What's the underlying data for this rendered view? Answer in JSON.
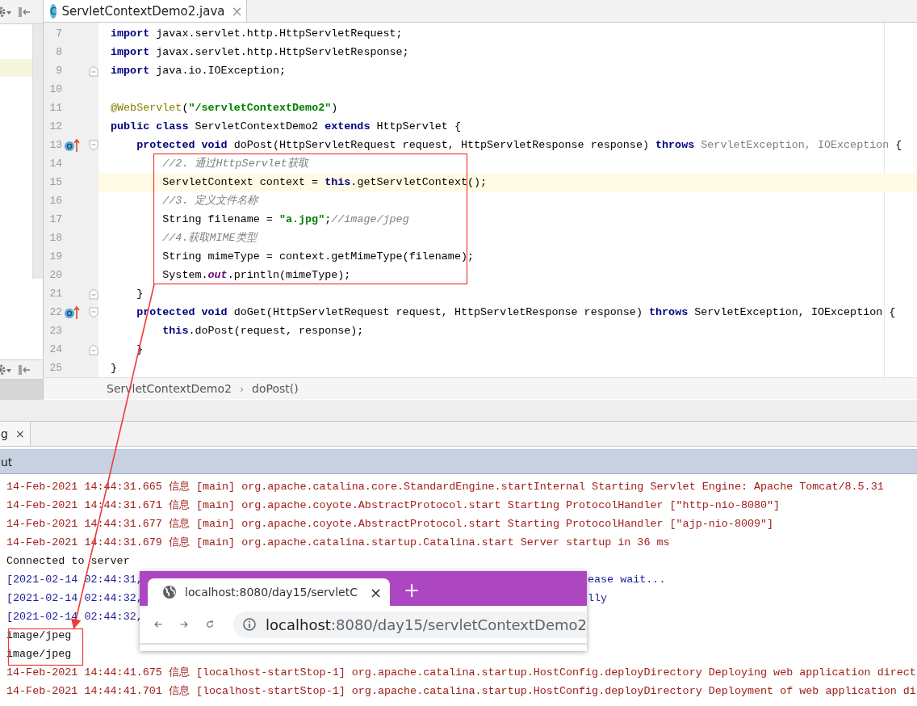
{
  "file_tab": {
    "icon_letter": "C",
    "title": "ServletContextDemo2.java",
    "close": "×",
    "selected": true
  },
  "code_lines": [
    {
      "number": "7",
      "current": false,
      "override": false,
      "fold_start": false,
      "fold_end": false,
      "tokens": [
        {
          "kind": "keyword",
          "text": "import"
        },
        {
          "kind": "plain",
          "text": " javax.servlet.http.HttpServletRequest;"
        }
      ]
    },
    {
      "number": "8",
      "current": false,
      "override": false,
      "fold_start": false,
      "fold_end": false,
      "tokens": [
        {
          "kind": "keyword",
          "text": "import"
        },
        {
          "kind": "plain",
          "text": " javax.servlet.http.HttpServletResponse;"
        }
      ]
    },
    {
      "number": "9",
      "current": false,
      "override": false,
      "fold_start": false,
      "fold_end": true,
      "tokens": [
        {
          "kind": "keyword",
          "text": "import"
        },
        {
          "kind": "plain",
          "text": " java.io.IOException;"
        }
      ]
    },
    {
      "number": "10",
      "current": false,
      "override": false,
      "fold_start": false,
      "fold_end": false
    },
    {
      "number": "11",
      "current": false,
      "override": false,
      "fold_start": false,
      "fold_end": false,
      "tokens": [
        {
          "kind": "annotation",
          "text": "@WebServlet"
        },
        {
          "kind": "plain",
          "text": "("
        },
        {
          "kind": "string",
          "text": "\"/servletContextDemo2\""
        },
        {
          "kind": "plain",
          "text": ")"
        }
      ]
    },
    {
      "number": "12",
      "current": false,
      "override": false,
      "fold_start": false,
      "fold_end": false,
      "tokens": [
        {
          "kind": "keyword",
          "text": "public class"
        },
        {
          "kind": "plain",
          "text": " ServletContextDemo2 "
        },
        {
          "kind": "keyword",
          "text": "extends"
        },
        {
          "kind": "plain",
          "text": " HttpServlet {"
        }
      ]
    },
    {
      "number": "13",
      "current": false,
      "override": true,
      "fold_start": true,
      "fold_end": false,
      "tokens": [
        {
          "kind": "keyword",
          "text": "    protected void"
        },
        {
          "kind": "plain",
          "text": " doPost(HttpServletRequest request, HttpServletResponse response) "
        },
        {
          "kind": "keyword",
          "text": "throws"
        },
        {
          "kind": "unused",
          "text": " ServletException, IOException"
        },
        {
          "kind": "plain",
          "text": " {"
        }
      ]
    },
    {
      "number": "14",
      "current": false,
      "override": false,
      "fold_start": false,
      "fold_end": false,
      "tokens": [
        {
          "kind": "comment",
          "text": "        //2. 通过HttpServlet获取"
        }
      ]
    },
    {
      "number": "15",
      "current": true,
      "override": false,
      "fold_start": false,
      "fold_end": false,
      "tokens": [
        {
          "kind": "plain",
          "text": "        ServletContext context = "
        },
        {
          "kind": "keyword",
          "text": "this"
        },
        {
          "kind": "plain",
          "text": ".getServletContext();"
        }
      ]
    },
    {
      "number": "16",
      "current": false,
      "override": false,
      "fold_start": false,
      "fold_end": false,
      "tokens": [
        {
          "kind": "comment",
          "text": "        //3. 定义文件名称"
        }
      ]
    },
    {
      "number": "17",
      "current": false,
      "override": false,
      "fold_start": false,
      "fold_end": false,
      "tokens": [
        {
          "kind": "plain",
          "text": "        String filename = "
        },
        {
          "kind": "string",
          "text": "\"a.jpg\""
        },
        {
          "kind": "plain",
          "text": ";"
        },
        {
          "kind": "comment",
          "text": "//image/jpeg"
        }
      ]
    },
    {
      "number": "18",
      "current": false,
      "override": false,
      "fold_start": false,
      "fold_end": false,
      "tokens": [
        {
          "kind": "comment",
          "text": "        //4.获取MIME类型"
        }
      ]
    },
    {
      "number": "19",
      "current": false,
      "override": false,
      "fold_start": false,
      "fold_end": false,
      "tokens": [
        {
          "kind": "plain",
          "text": "        String mimeType = context.getMimeType(filename);"
        }
      ]
    },
    {
      "number": "20",
      "current": false,
      "override": false,
      "fold_start": false,
      "fold_end": false,
      "tokens": [
        {
          "kind": "plain",
          "text": "        System."
        },
        {
          "kind": "static",
          "text": "out"
        },
        {
          "kind": "plain",
          "text": ".println(mimeType);"
        }
      ]
    },
    {
      "number": "21",
      "current": false,
      "override": false,
      "fold_start": false,
      "fold_end": true,
      "tokens": [
        {
          "kind": "plain",
          "text": "    }"
        }
      ]
    },
    {
      "number": "22",
      "current": false,
      "override": true,
      "fold_start": true,
      "fold_end": false,
      "tokens": [
        {
          "kind": "keyword",
          "text": "    protected void"
        },
        {
          "kind": "plain",
          "text": " doGet(HttpServletRequest request, HttpServletResponse response) "
        },
        {
          "kind": "keyword",
          "text": "throws"
        },
        {
          "kind": "plain",
          "text": " ServletException, IOException {"
        }
      ]
    },
    {
      "number": "23",
      "current": false,
      "override": false,
      "fold_start": false,
      "fold_end": false,
      "tokens": [
        {
          "kind": "keyword",
          "text": "        this"
        },
        {
          "kind": "plain",
          "text": ".doPost(request, response);"
        }
      ]
    },
    {
      "number": "24",
      "current": false,
      "override": false,
      "fold_start": false,
      "fold_end": true,
      "tokens": [
        {
          "kind": "plain",
          "text": "    }"
        }
      ]
    },
    {
      "number": "25",
      "current": false,
      "override": false,
      "fold_start": false,
      "fold_end": false,
      "tokens": [
        {
          "kind": "plain",
          "text": "}"
        }
      ]
    }
  ],
  "breadcrumb": [
    {
      "label": "ServletContextDemo2"
    },
    {
      "label": "doPost()"
    }
  ],
  "breadcrumb_separator": "›",
  "run_tab": {
    "label": "g",
    "close": "×"
  },
  "console_header": "ut",
  "console_lines": [
    {
      "kind": "stderr",
      "text": "14-Feb-2021 14:44:31.665 信息 [main] org.apache.catalina.core.StandardEngine.startInternal Starting Servlet Engine: Apache Tomcat/8.5.31"
    },
    {
      "kind": "stderr",
      "text": "14-Feb-2021 14:44:31.671 信息 [main] org.apache.coyote.AbstractProtocol.start Starting ProtocolHandler [\"http-nio-8080\"]"
    },
    {
      "kind": "stderr",
      "text": "14-Feb-2021 14:44:31.677 信息 [main] org.apache.coyote.AbstractProtocol.start Starting ProtocolHandler [\"ajp-nio-8009\"]"
    },
    {
      "kind": "stderr",
      "text": "14-Feb-2021 14:44:31.679 信息 [main] org.apache.catalina.startup.Catalina.start Server startup in 36 ms"
    },
    {
      "kind": "stdout",
      "text": "Connected to server"
    },
    {
      "kind": "system",
      "text": "[2021-02-14 02:44:31,",
      "tail": "ease wait..."
    },
    {
      "kind": "system",
      "text": "[2021-02-14 02:44:32,",
      "tail": "lly"
    },
    {
      "kind": "system",
      "text": "[2021-02-14 02:44:32,"
    },
    {
      "kind": "stdout",
      "text": "image/jpeg"
    },
    {
      "kind": "stdout",
      "text": "image/jpeg"
    },
    {
      "kind": "stderr",
      "text": "14-Feb-2021 14:44:41.675 信息 [localhost-startStop-1] org.apache.catalina.startup.HostConfig.deployDirectory Deploying web application direct"
    },
    {
      "kind": "stderr",
      "text": "14-Feb-2021 14:44:41.701 信息 [localhost-startStop-1] org.apache.catalina.startup.HostConfig.deployDirectory Deployment of web application di"
    }
  ],
  "browser": {
    "tab_title": "localhost:8080/day15/servletC",
    "tab_close": "×",
    "new_tab": "+",
    "url_host": "localhost",
    "url_path": ":8080/day15/servletContextDemo2"
  }
}
